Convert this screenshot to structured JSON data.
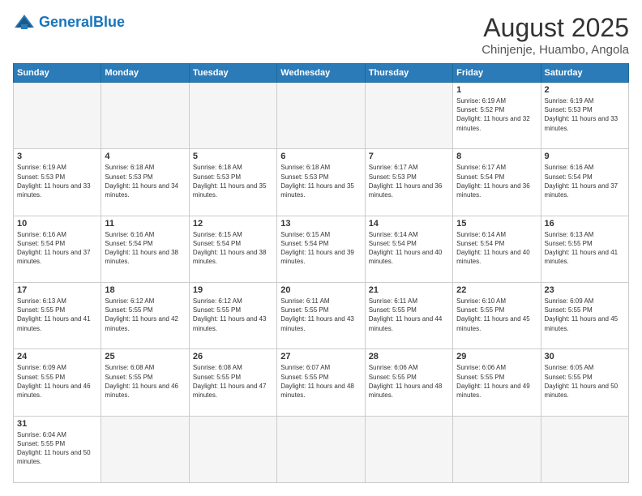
{
  "header": {
    "logo_general": "General",
    "logo_blue": "Blue",
    "title": "August 2025",
    "location": "Chinjenje, Huambo, Angola"
  },
  "days_of_week": [
    "Sunday",
    "Monday",
    "Tuesday",
    "Wednesday",
    "Thursday",
    "Friday",
    "Saturday"
  ],
  "weeks": [
    [
      {
        "day": "",
        "empty": true
      },
      {
        "day": "",
        "empty": true
      },
      {
        "day": "",
        "empty": true
      },
      {
        "day": "",
        "empty": true
      },
      {
        "day": "",
        "empty": true
      },
      {
        "day": "1",
        "sunrise": "6:19 AM",
        "sunset": "5:52 PM",
        "daylight": "11 hours and 32 minutes."
      },
      {
        "day": "2",
        "sunrise": "6:19 AM",
        "sunset": "5:53 PM",
        "daylight": "11 hours and 33 minutes."
      }
    ],
    [
      {
        "day": "3",
        "sunrise": "6:19 AM",
        "sunset": "5:53 PM",
        "daylight": "11 hours and 33 minutes."
      },
      {
        "day": "4",
        "sunrise": "6:18 AM",
        "sunset": "5:53 PM",
        "daylight": "11 hours and 34 minutes."
      },
      {
        "day": "5",
        "sunrise": "6:18 AM",
        "sunset": "5:53 PM",
        "daylight": "11 hours and 35 minutes."
      },
      {
        "day": "6",
        "sunrise": "6:18 AM",
        "sunset": "5:53 PM",
        "daylight": "11 hours and 35 minutes."
      },
      {
        "day": "7",
        "sunrise": "6:17 AM",
        "sunset": "5:53 PM",
        "daylight": "11 hours and 36 minutes."
      },
      {
        "day": "8",
        "sunrise": "6:17 AM",
        "sunset": "5:54 PM",
        "daylight": "11 hours and 36 minutes."
      },
      {
        "day": "9",
        "sunrise": "6:16 AM",
        "sunset": "5:54 PM",
        "daylight": "11 hours and 37 minutes."
      }
    ],
    [
      {
        "day": "10",
        "sunrise": "6:16 AM",
        "sunset": "5:54 PM",
        "daylight": "11 hours and 37 minutes."
      },
      {
        "day": "11",
        "sunrise": "6:16 AM",
        "sunset": "5:54 PM",
        "daylight": "11 hours and 38 minutes."
      },
      {
        "day": "12",
        "sunrise": "6:15 AM",
        "sunset": "5:54 PM",
        "daylight": "11 hours and 38 minutes."
      },
      {
        "day": "13",
        "sunrise": "6:15 AM",
        "sunset": "5:54 PM",
        "daylight": "11 hours and 39 minutes."
      },
      {
        "day": "14",
        "sunrise": "6:14 AM",
        "sunset": "5:54 PM",
        "daylight": "11 hours and 40 minutes."
      },
      {
        "day": "15",
        "sunrise": "6:14 AM",
        "sunset": "5:54 PM",
        "daylight": "11 hours and 40 minutes."
      },
      {
        "day": "16",
        "sunrise": "6:13 AM",
        "sunset": "5:55 PM",
        "daylight": "11 hours and 41 minutes."
      }
    ],
    [
      {
        "day": "17",
        "sunrise": "6:13 AM",
        "sunset": "5:55 PM",
        "daylight": "11 hours and 41 minutes."
      },
      {
        "day": "18",
        "sunrise": "6:12 AM",
        "sunset": "5:55 PM",
        "daylight": "11 hours and 42 minutes."
      },
      {
        "day": "19",
        "sunrise": "6:12 AM",
        "sunset": "5:55 PM",
        "daylight": "11 hours and 43 minutes."
      },
      {
        "day": "20",
        "sunrise": "6:11 AM",
        "sunset": "5:55 PM",
        "daylight": "11 hours and 43 minutes."
      },
      {
        "day": "21",
        "sunrise": "6:11 AM",
        "sunset": "5:55 PM",
        "daylight": "11 hours and 44 minutes."
      },
      {
        "day": "22",
        "sunrise": "6:10 AM",
        "sunset": "5:55 PM",
        "daylight": "11 hours and 45 minutes."
      },
      {
        "day": "23",
        "sunrise": "6:09 AM",
        "sunset": "5:55 PM",
        "daylight": "11 hours and 45 minutes."
      }
    ],
    [
      {
        "day": "24",
        "sunrise": "6:09 AM",
        "sunset": "5:55 PM",
        "daylight": "11 hours and 46 minutes."
      },
      {
        "day": "25",
        "sunrise": "6:08 AM",
        "sunset": "5:55 PM",
        "daylight": "11 hours and 46 minutes."
      },
      {
        "day": "26",
        "sunrise": "6:08 AM",
        "sunset": "5:55 PM",
        "daylight": "11 hours and 47 minutes."
      },
      {
        "day": "27",
        "sunrise": "6:07 AM",
        "sunset": "5:55 PM",
        "daylight": "11 hours and 48 minutes."
      },
      {
        "day": "28",
        "sunrise": "6:06 AM",
        "sunset": "5:55 PM",
        "daylight": "11 hours and 48 minutes."
      },
      {
        "day": "29",
        "sunrise": "6:06 AM",
        "sunset": "5:55 PM",
        "daylight": "11 hours and 49 minutes."
      },
      {
        "day": "30",
        "sunrise": "6:05 AM",
        "sunset": "5:55 PM",
        "daylight": "11 hours and 50 minutes."
      }
    ],
    [
      {
        "day": "31",
        "sunrise": "6:04 AM",
        "sunset": "5:55 PM",
        "daylight": "11 hours and 50 minutes."
      },
      {
        "day": "",
        "empty": true
      },
      {
        "day": "",
        "empty": true
      },
      {
        "day": "",
        "empty": true
      },
      {
        "day": "",
        "empty": true
      },
      {
        "day": "",
        "empty": true
      },
      {
        "day": "",
        "empty": true
      }
    ]
  ],
  "labels": {
    "sunrise": "Sunrise:",
    "sunset": "Sunset:",
    "daylight": "Daylight:"
  }
}
